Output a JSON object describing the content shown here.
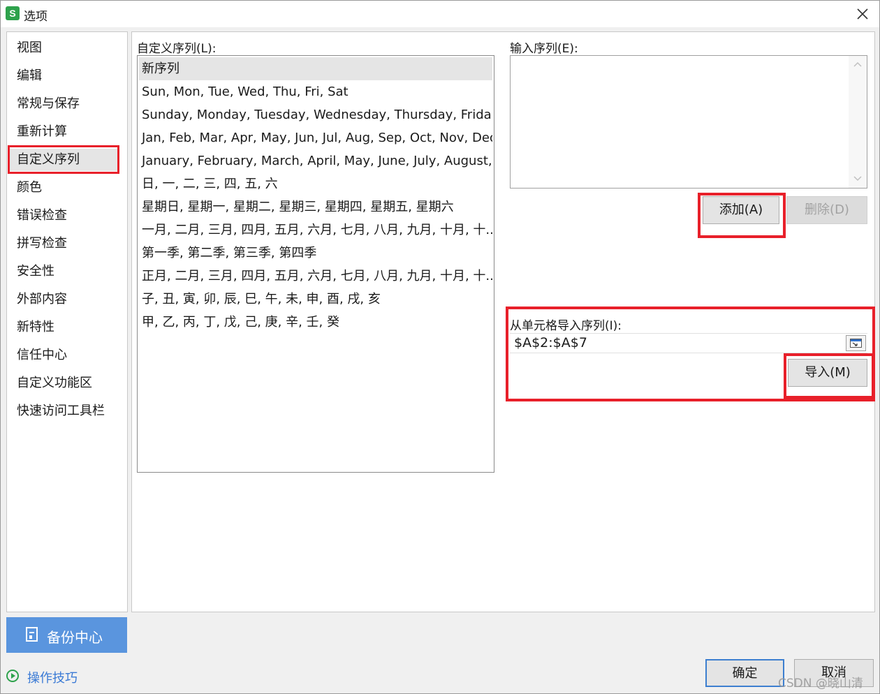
{
  "window": {
    "title": "选项",
    "app_icon_letter": "S"
  },
  "sidebar": {
    "items": [
      {
        "label": "视图"
      },
      {
        "label": "编辑"
      },
      {
        "label": "常规与保存"
      },
      {
        "label": "重新计算"
      },
      {
        "label": "自定义序列",
        "active": true
      },
      {
        "label": "颜色"
      },
      {
        "label": "错误检查"
      },
      {
        "label": "拼写检查"
      },
      {
        "label": "安全性"
      },
      {
        "label": "外部内容"
      },
      {
        "label": "新特性"
      },
      {
        "label": "信任中心"
      },
      {
        "label": "自定义功能区"
      },
      {
        "label": "快速访问工具栏"
      }
    ],
    "backup_label": "备份中心",
    "tips_label": "操作技巧"
  },
  "custom_lists": {
    "label": "自定义序列(L):",
    "items": [
      {
        "text": "新序列",
        "selected": true
      },
      {
        "text": "Sun, Mon, Tue, Wed, Thu, Fri, Sat"
      },
      {
        "text": "Sunday, Monday, Tuesday, Wednesday, Thursday, Frida..."
      },
      {
        "text": "Jan, Feb, Mar, Apr, May, Jun, Jul, Aug, Sep, Oct, Nov, Dec"
      },
      {
        "text": "January, February, March, April, May, June, July, August, ..."
      },
      {
        "text": "日, 一, 二, 三, 四, 五, 六"
      },
      {
        "text": "星期日, 星期一, 星期二, 星期三, 星期四, 星期五, 星期六"
      },
      {
        "text": "一月, 二月, 三月, 四月, 五月, 六月, 七月, 八月, 九月, 十月, 十..."
      },
      {
        "text": "第一季, 第二季, 第三季, 第四季"
      },
      {
        "text": "正月, 二月, 三月, 四月, 五月, 六月, 七月, 八月, 九月, 十月, 十..."
      },
      {
        "text": "子, 丑, 寅, 卯, 辰, 巳, 午, 未, 申, 酉, 戌, 亥"
      },
      {
        "text": "甲, 乙, 丙, 丁, 戊, 己, 庚, 辛, 壬, 癸"
      }
    ]
  },
  "entries": {
    "label": "输入序列(E):",
    "value": ""
  },
  "buttons": {
    "add": "添加(A)",
    "delete": "删除(D)",
    "import": "导入(M)",
    "ok": "确定",
    "cancel": "取消"
  },
  "import_range": {
    "label": "从单元格导入序列(I):",
    "value": "$A$2:$A$7"
  },
  "colors": {
    "highlight": "#e8202a",
    "backup_bg": "#5a95de",
    "accent": "#3d7fd0",
    "app_icon": "#2ea24c"
  },
  "watermark": "CSDN @晓山清"
}
